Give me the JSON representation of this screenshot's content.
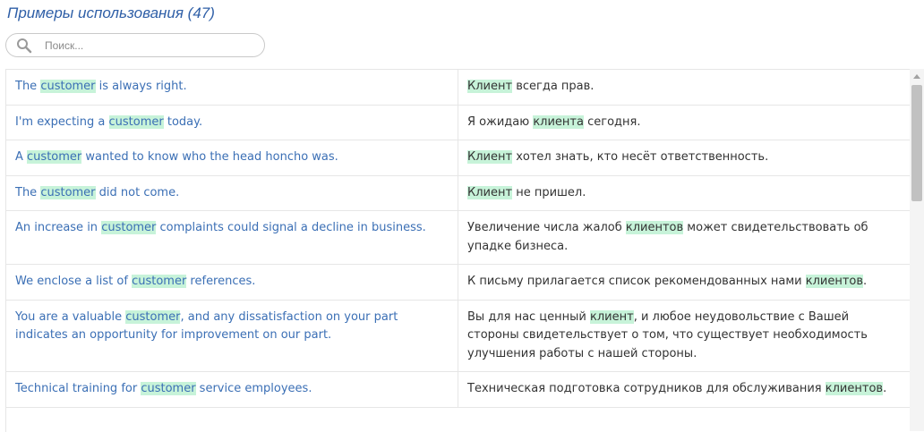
{
  "header": {
    "title": "Примеры использования (47)"
  },
  "search": {
    "placeholder": "Поиск..."
  },
  "examples": [
    {
      "en": [
        [
          "The ",
          false
        ],
        [
          "customer",
          true
        ],
        [
          " is always right.",
          false
        ]
      ],
      "ru": [
        [
          "Клиент",
          true
        ],
        [
          " всегда прав.",
          false
        ]
      ]
    },
    {
      "en": [
        [
          "I'm expecting a ",
          false
        ],
        [
          "customer",
          true
        ],
        [
          " today.",
          false
        ]
      ],
      "ru": [
        [
          "Я ожидаю ",
          false
        ],
        [
          "клиента",
          true
        ],
        [
          " сегодня.",
          false
        ]
      ]
    },
    {
      "en": [
        [
          "A ",
          false
        ],
        [
          "customer",
          true
        ],
        [
          " wanted to know who the head honcho was.",
          false
        ]
      ],
      "ru": [
        [
          "Клиент",
          true
        ],
        [
          " хотел знать, кто несёт ответственность.",
          false
        ]
      ]
    },
    {
      "en": [
        [
          "The ",
          false
        ],
        [
          "customer",
          true
        ],
        [
          " did not come.",
          false
        ]
      ],
      "ru": [
        [
          "Клиент",
          true
        ],
        [
          " не пришел.",
          false
        ]
      ]
    },
    {
      "en": [
        [
          "An increase in ",
          false
        ],
        [
          "customer",
          true
        ],
        [
          " complaints could signal a decline in business.",
          false
        ]
      ],
      "ru": [
        [
          "Увеличение числа жалоб ",
          false
        ],
        [
          "клиентов",
          true
        ],
        [
          " может свидетельствовать об упадке бизнеса.",
          false
        ]
      ]
    },
    {
      "en": [
        [
          "We enclose a list of ",
          false
        ],
        [
          "customer",
          true
        ],
        [
          " references.",
          false
        ]
      ],
      "ru": [
        [
          "К письму прилагается список рекомендованных нами ",
          false
        ],
        [
          "клиентов",
          true
        ],
        [
          ".",
          false
        ]
      ]
    },
    {
      "en": [
        [
          "You are a valuable ",
          false
        ],
        [
          "customer",
          true
        ],
        [
          ", and any dissatisfaction on your part indicates an opportunity for improvement on our part.",
          false
        ]
      ],
      "ru": [
        [
          "Вы для нас ценный ",
          false
        ],
        [
          "клиент",
          true
        ],
        [
          ", и любое неудовольствие с Вашей стороны свидетельствует о том, что существует необходимость улучшения работы с нашей стороны.",
          false
        ]
      ]
    },
    {
      "en": [
        [
          "Technical training for ",
          false
        ],
        [
          "customer",
          true
        ],
        [
          " service employees.",
          false
        ]
      ],
      "ru": [
        [
          "Техническая подготовка сотрудников для обслуживания ",
          false
        ],
        [
          "клиентов",
          true
        ],
        [
          ".",
          false
        ]
      ]
    }
  ]
}
